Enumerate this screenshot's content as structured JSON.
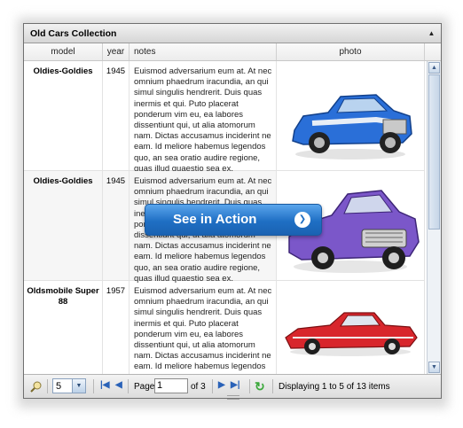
{
  "panel": {
    "title": "Old Cars Collection"
  },
  "columns": [
    {
      "key": "model",
      "label": "model"
    },
    {
      "key": "year",
      "label": "year"
    },
    {
      "key": "notes",
      "label": "notes"
    },
    {
      "key": "photo",
      "label": "photo"
    }
  ],
  "rows": [
    {
      "model": "Oldies-Goldies",
      "year": "1945",
      "notes": "Euismod adversarium eum at. At nec omnium phaedrum iracundia, an qui simul singulis hendrerit. Duis quas inermis et qui. Puto placerat ponderum vim eu, ea labores dissentiunt qui, ut alia atomorum nam. Dictas accusamus inciderint ne eam. Id meliore habemus legendos quo, an sea oratio audire regione, quas illud quaestio sea ex.",
      "photo_icon": "blue-classic-car-photo",
      "car_color": "#2a6fd8"
    },
    {
      "model": "Oldies-Goldies",
      "year": "1945",
      "notes": "Euismod adversarium eum at. At nec omnium phaedrum iracundia, an qui simul singulis hendrerit. Duis quas inermis et qui. Puto placerat ponderum vim eu, ea labores dissentiunt qui, ut alia atomorum nam. Dictas accusamus inciderint ne eam. Id meliore habemus legendos quo, an sea oratio audire regione, quas illud quaestio sea ex.",
      "photo_icon": "purple-classic-car-photo",
      "car_color": "#7b57c9"
    },
    {
      "model": "Oldsmobile Super 88",
      "year": "1957",
      "notes": "Euismod adversarium eum at. At nec omnium phaedrum iracundia, an qui simul singulis hendrerit. Duis quas inermis et qui. Puto placerat ponderum vim eu, ea labores dissentiunt qui, ut alia atomorum nam. Dictas accusamus inciderint ne eam. Id meliore habemus legendos quo, an sea oratio audire regione, quas illud quaestio sea ex.",
      "photo_icon": "red-classic-car-photo",
      "car_color": "#d8262c"
    }
  ],
  "toolbar": {
    "page_size": "5",
    "page_label": "Page",
    "page_value": "1",
    "of_label": "of 3",
    "display_text": "Displaying 1 to 5 of 13 items"
  },
  "overlay": {
    "label": "See in Action"
  },
  "colors": {
    "accent": "#1f6fc4",
    "nav": "#2a62b8",
    "refresh": "#3aa83a"
  }
}
